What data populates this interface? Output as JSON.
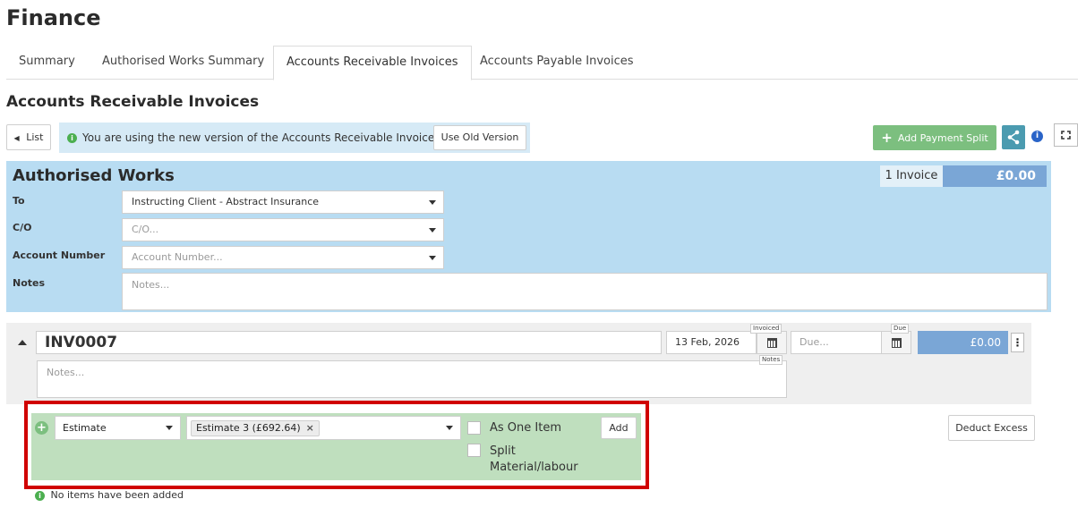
{
  "page": {
    "title": "Finance"
  },
  "tabs": [
    {
      "label": "Summary",
      "active": false
    },
    {
      "label": "Authorised Works Summary",
      "active": false
    },
    {
      "label": "Accounts Receivable Invoices",
      "active": true
    },
    {
      "label": "Accounts Payable Invoices",
      "active": false
    }
  ],
  "section": {
    "title": "Accounts Receivable Invoices"
  },
  "toolbar": {
    "list_label": "List",
    "info_message": "You are using the new version of the Accounts Receivable Invoices",
    "old_version_label": "Use Old Version",
    "add_payment_split_label": "Add Payment Split"
  },
  "authorised_works": {
    "title": "Authorised Works",
    "invoice_count": "1 Invoice",
    "total": "£0.00",
    "fields": {
      "to_label": "To",
      "to_value": "Instructing Client - Abstract Insurance",
      "co_label": "C/O",
      "co_placeholder": "C/O...",
      "account_label": "Account Number",
      "account_placeholder": "Account Number...",
      "notes_label": "Notes",
      "notes_placeholder": "Notes..."
    }
  },
  "invoice": {
    "number": "INV0007",
    "invoiced_date": "13 Feb, 2026",
    "invoiced_tag": "Invoiced",
    "due_placeholder": "Due...",
    "due_tag": "Due",
    "amount": "£0.00",
    "notes_placeholder": "Notes...",
    "notes_tag": "Notes"
  },
  "item_entry": {
    "type_value": "Estimate",
    "selected_chip": "Estimate 3 (£692.64)",
    "as_one_item_label": "As One Item",
    "split_label_line1": "Split",
    "split_label_line2": "Material/labour",
    "add_label": "Add"
  },
  "deduct_excess_label": "Deduct Excess",
  "no_items_text": "No items have been added",
  "colors": {
    "panel_blue": "#b8dcf2",
    "total_blue": "#7aa6d6",
    "green_button": "#7cbf7f",
    "green_panel": "#bfdfbe",
    "highlight_red": "#d00000"
  }
}
